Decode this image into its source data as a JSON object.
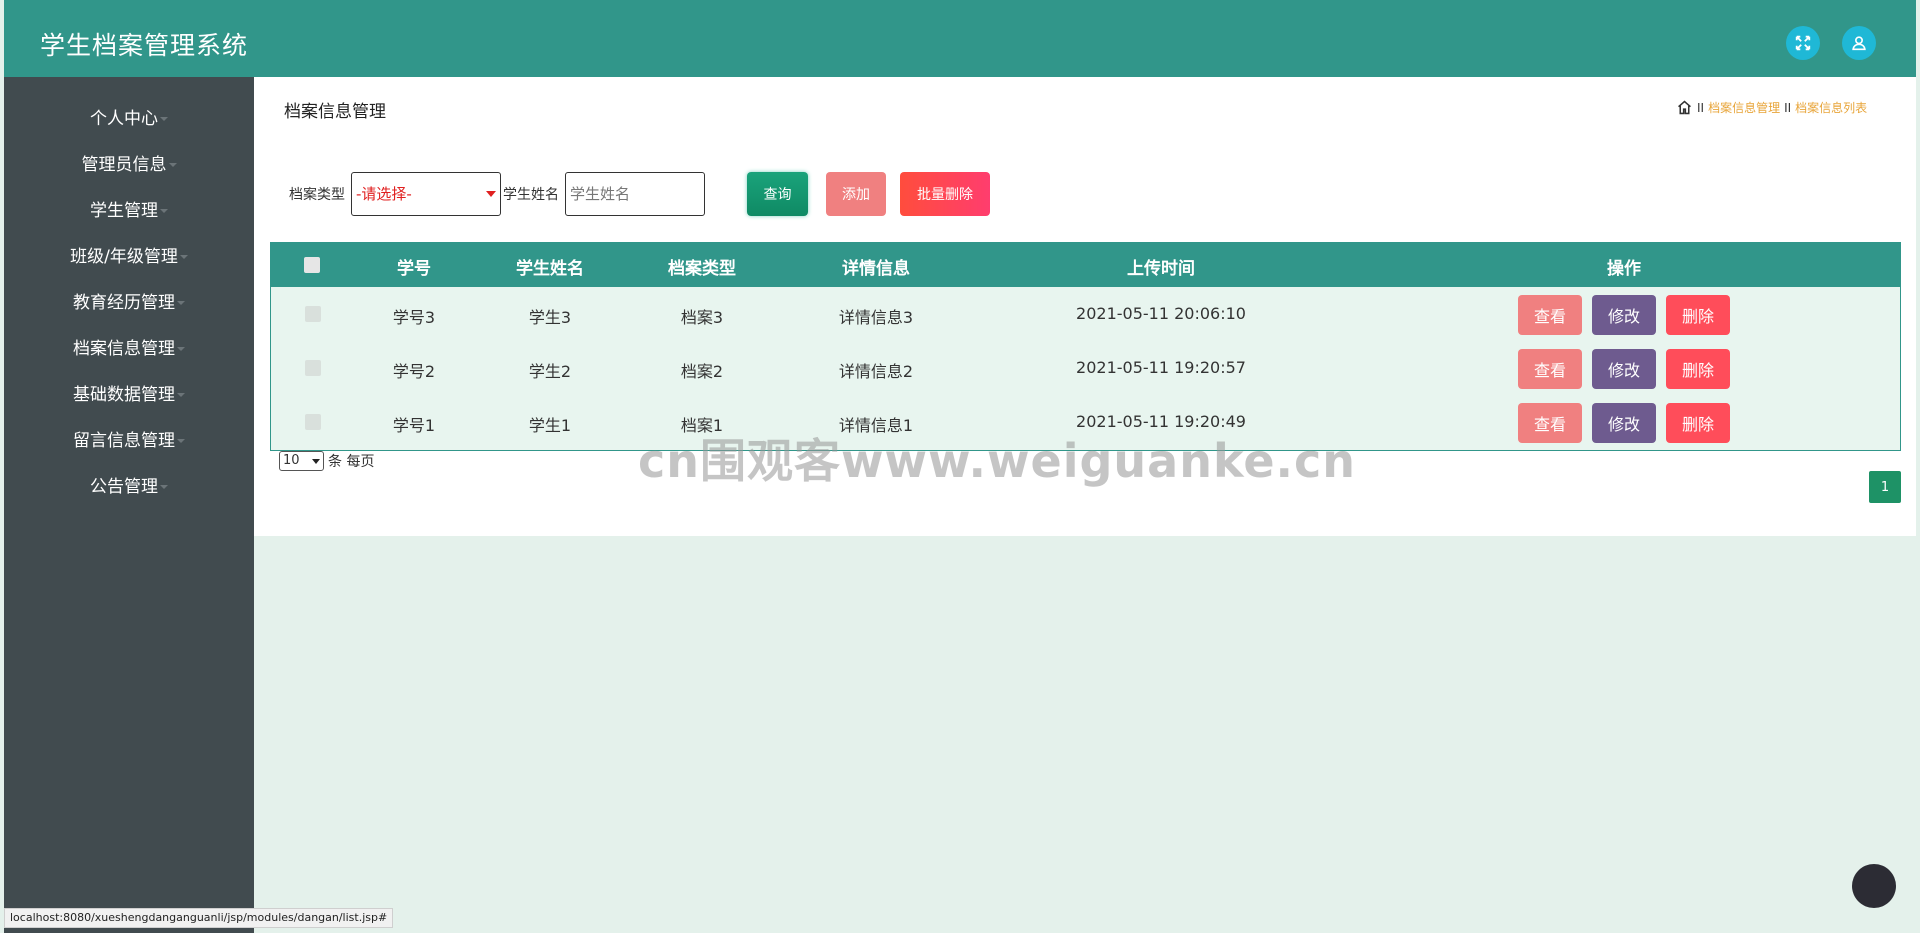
{
  "header": {
    "title": "学生档案管理系统"
  },
  "sidebar": {
    "items": [
      {
        "label": "个人中心"
      },
      {
        "label": "管理员信息"
      },
      {
        "label": "学生管理"
      },
      {
        "label": "班级/年级管理"
      },
      {
        "label": "教育经历管理"
      },
      {
        "label": "档案信息管理"
      },
      {
        "label": "基础数据管理"
      },
      {
        "label": "留言信息管理"
      },
      {
        "label": "公告管理"
      }
    ]
  },
  "page": {
    "title": "档案信息管理"
  },
  "breadcrumb": {
    "sep1": "II",
    "item1": "档案信息管理",
    "sep2": "II",
    "item2": "档案信息列表"
  },
  "search": {
    "type_label": "档案类型",
    "type_value": "-请选择-",
    "name_label": "学生姓名",
    "name_placeholder": "学生姓名",
    "search_btn": "查询",
    "add_btn": "添加",
    "batch_delete_btn": "批量删除"
  },
  "table": {
    "headers": [
      "学号",
      "学生姓名",
      "档案类型",
      "详情信息",
      "上传时间",
      "操作"
    ],
    "rows": [
      [
        "学号3",
        "学生3",
        "档案3",
        "详情信息3",
        "2021-05-11 20:06:10"
      ],
      [
        "学号2",
        "学生2",
        "档案2",
        "详情信息2",
        "2021-05-11 19:20:57"
      ],
      [
        "学号1",
        "学生1",
        "档案1",
        "详情信息1",
        "2021-05-11 19:20:49"
      ]
    ],
    "actions": {
      "view": "查看",
      "edit": "修改",
      "delete": "删除"
    }
  },
  "pagination": {
    "per_page_value": "10",
    "per_page_label": "条 每页",
    "current_page": "1"
  },
  "watermark": "cn围观客www.weiguanke.cn",
  "statusbar": {
    "url": "localhost:8080/xueshengdanganguanli/jsp/modules/dangan/list.jsp#"
  },
  "colors": {
    "primary": "#31968a",
    "sidebar": "#414b4f",
    "accent": "#e8a53a",
    "view": "#f08080",
    "edit": "#6e5b8f",
    "delete": "#ff4d5a"
  },
  "icons": {
    "fullscreen": "fullscreen-icon",
    "user": "user-icon",
    "home": "home-icon"
  }
}
